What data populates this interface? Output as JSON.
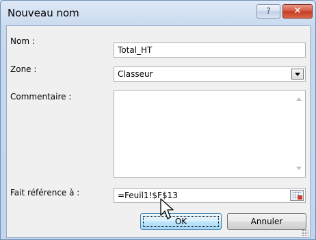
{
  "window": {
    "title": "Nouveau nom",
    "help_label": "?",
    "close_label": "✕"
  },
  "form": {
    "name_label": "Nom :",
    "name_value": "Total_HT",
    "zone_label": "Zone :",
    "zone_value": "Classeur",
    "comment_label": "Commentaire :",
    "comment_value": "",
    "ref_label": "Fait référence à :",
    "ref_value": "=Feuil1!$F$13"
  },
  "buttons": {
    "ok_label": "OK",
    "cancel_label": "Annuler"
  },
  "icons": {
    "combo": "chevron-down-icon",
    "reference": "range-selector-icon",
    "cursor": "mouse-pointer-icon"
  }
}
